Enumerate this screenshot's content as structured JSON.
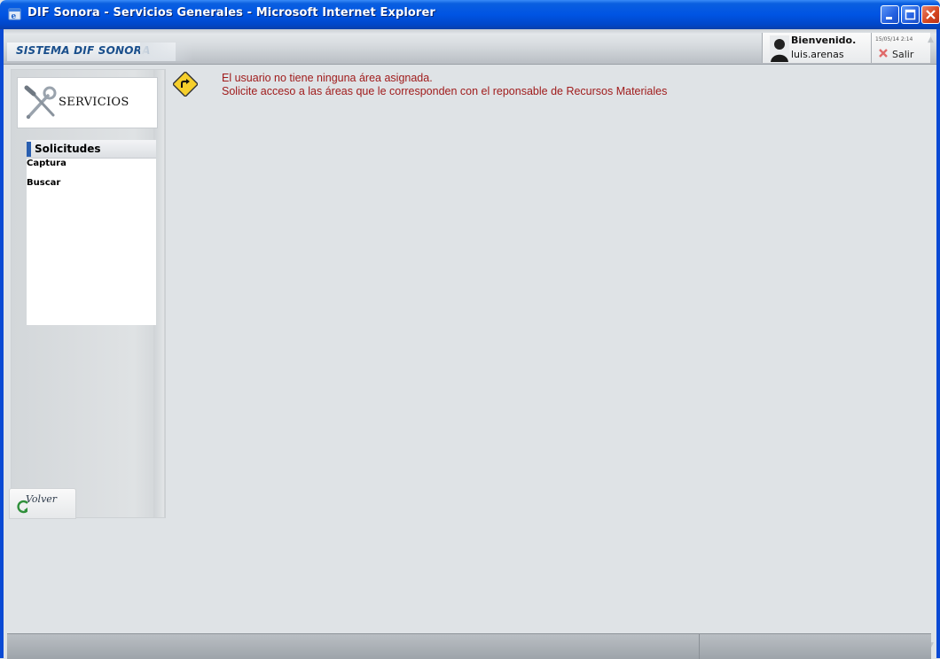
{
  "window": {
    "title": "DIF Sonora - Servicios Generales - Microsoft Internet Explorer"
  },
  "header": {
    "brand": "SISTEMA DIF SONORA",
    "welcome": "Bienvenido.",
    "username": "luis.arenas",
    "date": "15/05/14 2:14",
    "exit_label": "Salir"
  },
  "sidebar": {
    "title": "SERVICIOS",
    "section_label": "Solicitudes",
    "items": [
      {
        "label": "Captura"
      },
      {
        "label": "Buscar"
      }
    ],
    "back_label": "Volver"
  },
  "main": {
    "message_line1": "El usuario no tiene ninguna área asignada.",
    "message_line2": "Solicite acceso a las áreas que le corresponden con el reponsable de Recursos Materiales"
  },
  "colors": {
    "titlebar": "#0054e3",
    "brand_text": "#1a4f8c",
    "message_text": "#a01c1c",
    "menu_marker": "#2a5fb0"
  }
}
